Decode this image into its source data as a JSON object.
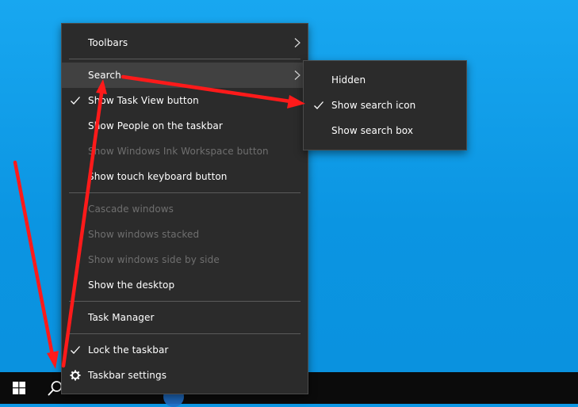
{
  "context_menu": {
    "items": [
      {
        "label": "Toolbars"
      },
      {
        "label": "Search"
      },
      {
        "label": "Show Task View button"
      },
      {
        "label": "Show People on the taskbar"
      },
      {
        "label": "Show Windows Ink Workspace button"
      },
      {
        "label": "Show touch keyboard button"
      },
      {
        "label": "Cascade windows"
      },
      {
        "label": "Show windows stacked"
      },
      {
        "label": "Show windows side by side"
      },
      {
        "label": "Show the desktop"
      },
      {
        "label": "Task Manager"
      },
      {
        "label": "Lock the taskbar"
      },
      {
        "label": "Taskbar settings"
      }
    ]
  },
  "search_submenu": {
    "items": [
      {
        "label": "Hidden"
      },
      {
        "label": "Show search icon"
      },
      {
        "label": "Show search box"
      }
    ]
  },
  "taskbar": {
    "icons": [
      "windows-start-icon",
      "search-icon"
    ]
  },
  "colors": {
    "desktop": "#0d98e6",
    "menu_background": "#2b2b2b",
    "menu_hover": "#414141",
    "text": "#ffffff",
    "disabled_text": "#6f6f6f",
    "annotation_arrow": "#ff1a1a"
  }
}
